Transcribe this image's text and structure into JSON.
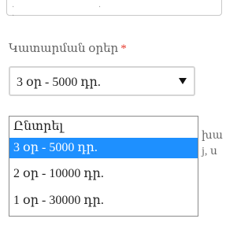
{
  "field": {
    "label": "Կատարման օրեր",
    "required_mark": "*",
    "selected_value": "3 օր - 5000 դր."
  },
  "dropdown": {
    "options": [
      {
        "label": "Ընտրել",
        "selected": false
      },
      {
        "label": "3 օր - 5000 դր.",
        "selected": true
      },
      {
        "label": "2 օր - 10000 դր.",
        "selected": false
      },
      {
        "label": "1 օր - 30000 դր.",
        "selected": false
      }
    ]
  },
  "obscured_text": {
    "line1": "խա",
    "line2": "j, ս"
  },
  "colors": {
    "selection": "#1e90ff",
    "required": "#e63b2e"
  }
}
